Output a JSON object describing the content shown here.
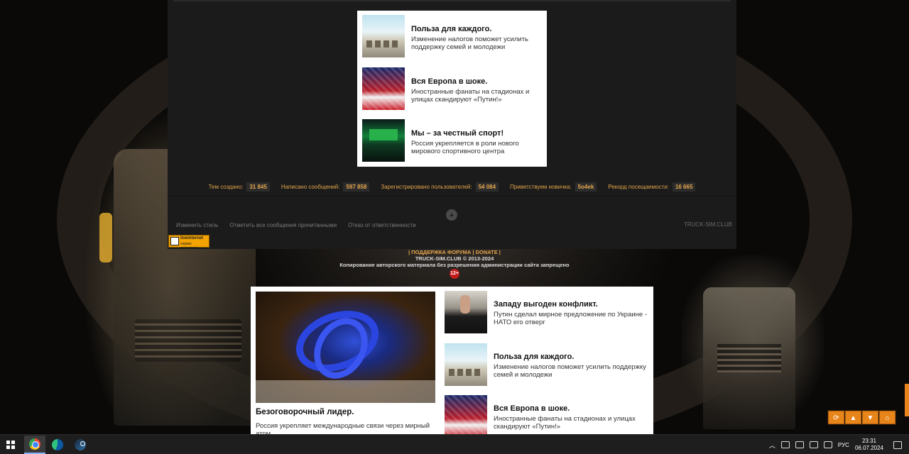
{
  "ad_top": {
    "items": [
      {
        "title": "Польза для каждого.",
        "desc": "Изменение налогов поможет усилить поддержку семей и молодежи",
        "thumb": "classroom-photo"
      },
      {
        "title": "Вся Европа в шоке.",
        "desc": "Иностранные фанаты на стадионах и улицах скандируют «Путин!»",
        "thumb": "football-fans-photo"
      },
      {
        "title": "Мы – за честный спорт!",
        "desc": "Россия укрепляется в роли нового мирового спортивного центра",
        "thumb": "sports-arena-photo"
      }
    ]
  },
  "stats": [
    {
      "label": "Тем создано:",
      "value": "31 845"
    },
    {
      "label": "Написано сообщений:",
      "value": "597 858"
    },
    {
      "label": "Зарегистрировано пользователей:",
      "value": "54 084"
    },
    {
      "label": "Приветствуем новичка:",
      "value": "5o4ek"
    },
    {
      "label": "Рекорд посещаемости:",
      "value": "16 665"
    }
  ],
  "footer": {
    "links": [
      "Изменить стиль",
      "Отметить все сообщения прочитанными",
      "Отказ от ответственности"
    ],
    "site": "TRUCK-SIM.CLUB",
    "liveinternet_1": "liveinternet",
    "liveinternet_2": "сервис статистики"
  },
  "copyright": {
    "support": "| ПОДДЕРЖКА ФОРУМА | DONATE |",
    "line2": "TRUCK-SIM.CLUB © 2013-2024",
    "line3": "Копирование авторского материала без разрешения администрации сайта запрещено",
    "age": "12+"
  },
  "ad_bottom": {
    "big_title": "Безоговорочный лидер.",
    "big_desc": "Россия укрепляет международные связи через мирный атом",
    "items": [
      {
        "title": "Западу выгоден конфликт.",
        "desc": "Путин сделал мирное предложение по Украине - НАТО его отверг",
        "thumb": "man-in-suit-photo"
      },
      {
        "title": "Польза для каждого.",
        "desc": "Изменение налогов поможет усилить поддержку семей и молодежи",
        "thumb": "classroom-photo"
      },
      {
        "title": "Вся Европа в шоке.",
        "desc": "Иностранные фанаты на стадионах и улицах скандируют «Путин!»",
        "thumb": "football-fans-photo"
      }
    ]
  },
  "nav_buttons": [
    "refresh-icon",
    "arrow-up-icon",
    "arrow-down-icon",
    "home-icon"
  ],
  "taskbar": {
    "lang": "РУС",
    "time": "23:31",
    "date": "06.07.2024"
  }
}
